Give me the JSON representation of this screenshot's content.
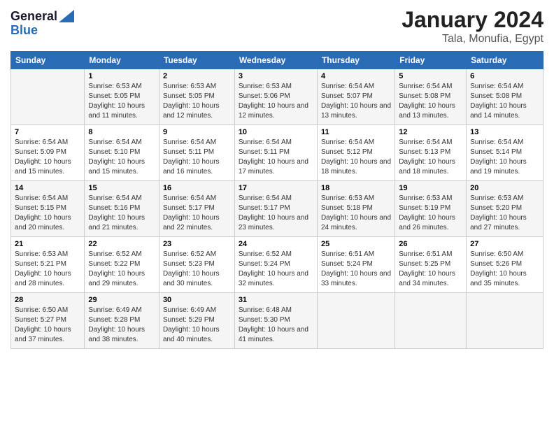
{
  "logo": {
    "line1": "General",
    "line2": "Blue"
  },
  "title": "January 2024",
  "subtitle": "Tala, Monufia, Egypt",
  "days_of_week": [
    "Sunday",
    "Monday",
    "Tuesday",
    "Wednesday",
    "Thursday",
    "Friday",
    "Saturday"
  ],
  "weeks": [
    [
      {
        "day": "",
        "sunrise": "",
        "sunset": "",
        "daylight": ""
      },
      {
        "day": "1",
        "sunrise": "Sunrise: 6:53 AM",
        "sunset": "Sunset: 5:05 PM",
        "daylight": "Daylight: 10 hours and 11 minutes."
      },
      {
        "day": "2",
        "sunrise": "Sunrise: 6:53 AM",
        "sunset": "Sunset: 5:05 PM",
        "daylight": "Daylight: 10 hours and 12 minutes."
      },
      {
        "day": "3",
        "sunrise": "Sunrise: 6:53 AM",
        "sunset": "Sunset: 5:06 PM",
        "daylight": "Daylight: 10 hours and 12 minutes."
      },
      {
        "day": "4",
        "sunrise": "Sunrise: 6:54 AM",
        "sunset": "Sunset: 5:07 PM",
        "daylight": "Daylight: 10 hours and 13 minutes."
      },
      {
        "day": "5",
        "sunrise": "Sunrise: 6:54 AM",
        "sunset": "Sunset: 5:08 PM",
        "daylight": "Daylight: 10 hours and 13 minutes."
      },
      {
        "day": "6",
        "sunrise": "Sunrise: 6:54 AM",
        "sunset": "Sunset: 5:08 PM",
        "daylight": "Daylight: 10 hours and 14 minutes."
      }
    ],
    [
      {
        "day": "7",
        "sunrise": "Sunrise: 6:54 AM",
        "sunset": "Sunset: 5:09 PM",
        "daylight": "Daylight: 10 hours and 15 minutes."
      },
      {
        "day": "8",
        "sunrise": "Sunrise: 6:54 AM",
        "sunset": "Sunset: 5:10 PM",
        "daylight": "Daylight: 10 hours and 15 minutes."
      },
      {
        "day": "9",
        "sunrise": "Sunrise: 6:54 AM",
        "sunset": "Sunset: 5:11 PM",
        "daylight": "Daylight: 10 hours and 16 minutes."
      },
      {
        "day": "10",
        "sunrise": "Sunrise: 6:54 AM",
        "sunset": "Sunset: 5:11 PM",
        "daylight": "Daylight: 10 hours and 17 minutes."
      },
      {
        "day": "11",
        "sunrise": "Sunrise: 6:54 AM",
        "sunset": "Sunset: 5:12 PM",
        "daylight": "Daylight: 10 hours and 18 minutes."
      },
      {
        "day": "12",
        "sunrise": "Sunrise: 6:54 AM",
        "sunset": "Sunset: 5:13 PM",
        "daylight": "Daylight: 10 hours and 18 minutes."
      },
      {
        "day": "13",
        "sunrise": "Sunrise: 6:54 AM",
        "sunset": "Sunset: 5:14 PM",
        "daylight": "Daylight: 10 hours and 19 minutes."
      }
    ],
    [
      {
        "day": "14",
        "sunrise": "Sunrise: 6:54 AM",
        "sunset": "Sunset: 5:15 PM",
        "daylight": "Daylight: 10 hours and 20 minutes."
      },
      {
        "day": "15",
        "sunrise": "Sunrise: 6:54 AM",
        "sunset": "Sunset: 5:16 PM",
        "daylight": "Daylight: 10 hours and 21 minutes."
      },
      {
        "day": "16",
        "sunrise": "Sunrise: 6:54 AM",
        "sunset": "Sunset: 5:17 PM",
        "daylight": "Daylight: 10 hours and 22 minutes."
      },
      {
        "day": "17",
        "sunrise": "Sunrise: 6:54 AM",
        "sunset": "Sunset: 5:17 PM",
        "daylight": "Daylight: 10 hours and 23 minutes."
      },
      {
        "day": "18",
        "sunrise": "Sunrise: 6:53 AM",
        "sunset": "Sunset: 5:18 PM",
        "daylight": "Daylight: 10 hours and 24 minutes."
      },
      {
        "day": "19",
        "sunrise": "Sunrise: 6:53 AM",
        "sunset": "Sunset: 5:19 PM",
        "daylight": "Daylight: 10 hours and 26 minutes."
      },
      {
        "day": "20",
        "sunrise": "Sunrise: 6:53 AM",
        "sunset": "Sunset: 5:20 PM",
        "daylight": "Daylight: 10 hours and 27 minutes."
      }
    ],
    [
      {
        "day": "21",
        "sunrise": "Sunrise: 6:53 AM",
        "sunset": "Sunset: 5:21 PM",
        "daylight": "Daylight: 10 hours and 28 minutes."
      },
      {
        "day": "22",
        "sunrise": "Sunrise: 6:52 AM",
        "sunset": "Sunset: 5:22 PM",
        "daylight": "Daylight: 10 hours and 29 minutes."
      },
      {
        "day": "23",
        "sunrise": "Sunrise: 6:52 AM",
        "sunset": "Sunset: 5:23 PM",
        "daylight": "Daylight: 10 hours and 30 minutes."
      },
      {
        "day": "24",
        "sunrise": "Sunrise: 6:52 AM",
        "sunset": "Sunset: 5:24 PM",
        "daylight": "Daylight: 10 hours and 32 minutes."
      },
      {
        "day": "25",
        "sunrise": "Sunrise: 6:51 AM",
        "sunset": "Sunset: 5:24 PM",
        "daylight": "Daylight: 10 hours and 33 minutes."
      },
      {
        "day": "26",
        "sunrise": "Sunrise: 6:51 AM",
        "sunset": "Sunset: 5:25 PM",
        "daylight": "Daylight: 10 hours and 34 minutes."
      },
      {
        "day": "27",
        "sunrise": "Sunrise: 6:50 AM",
        "sunset": "Sunset: 5:26 PM",
        "daylight": "Daylight: 10 hours and 35 minutes."
      }
    ],
    [
      {
        "day": "28",
        "sunrise": "Sunrise: 6:50 AM",
        "sunset": "Sunset: 5:27 PM",
        "daylight": "Daylight: 10 hours and 37 minutes."
      },
      {
        "day": "29",
        "sunrise": "Sunrise: 6:49 AM",
        "sunset": "Sunset: 5:28 PM",
        "daylight": "Daylight: 10 hours and 38 minutes."
      },
      {
        "day": "30",
        "sunrise": "Sunrise: 6:49 AM",
        "sunset": "Sunset: 5:29 PM",
        "daylight": "Daylight: 10 hours and 40 minutes."
      },
      {
        "day": "31",
        "sunrise": "Sunrise: 6:48 AM",
        "sunset": "Sunset: 5:30 PM",
        "daylight": "Daylight: 10 hours and 41 minutes."
      },
      {
        "day": "",
        "sunrise": "",
        "sunset": "",
        "daylight": ""
      },
      {
        "day": "",
        "sunrise": "",
        "sunset": "",
        "daylight": ""
      },
      {
        "day": "",
        "sunrise": "",
        "sunset": "",
        "daylight": ""
      }
    ]
  ]
}
